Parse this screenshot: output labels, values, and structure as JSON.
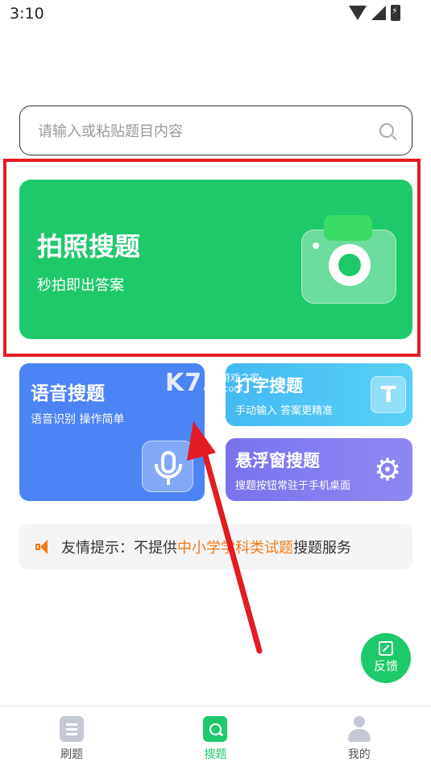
{
  "status_bar": {
    "time": "3:10"
  },
  "search": {
    "placeholder": "请输入或粘贴题目内容"
  },
  "photo_card": {
    "title": "拍照搜题",
    "subtitle": "秒拍即出答案"
  },
  "voice_card": {
    "title": "语音搜题",
    "subtitle": "语音识别 操作简单"
  },
  "type_card": {
    "title": "打字搜题",
    "subtitle": "手动输入 答案更精准",
    "icon_glyph": "T"
  },
  "float_card": {
    "title": "悬浮窗搜题",
    "subtitle": "搜题按钮常驻于手机桌面"
  },
  "tip": {
    "prefix": "友情提示：不提供",
    "highlight": "中小学学科类试题",
    "suffix": "搜题服务",
    "highlight_color": "#f07a1a"
  },
  "watermark": {
    "logo": "K73",
    "line1": "游戏之家",
    "line2": ".com"
  },
  "feedback": {
    "label": "反馈"
  },
  "bottom_nav": {
    "items": [
      {
        "label": "刷题",
        "icon": "brush-icon",
        "active": false
      },
      {
        "label": "搜题",
        "icon": "search-icon",
        "active": true
      },
      {
        "label": "我的",
        "icon": "profile-icon",
        "active": false
      }
    ]
  },
  "colors": {
    "brand_green": "#1ec96b",
    "voice_blue": "#4b84f4",
    "type_cyan": "#45b9f3",
    "float_purple": "#7a72ee",
    "highlight_red": "#e31b23"
  }
}
